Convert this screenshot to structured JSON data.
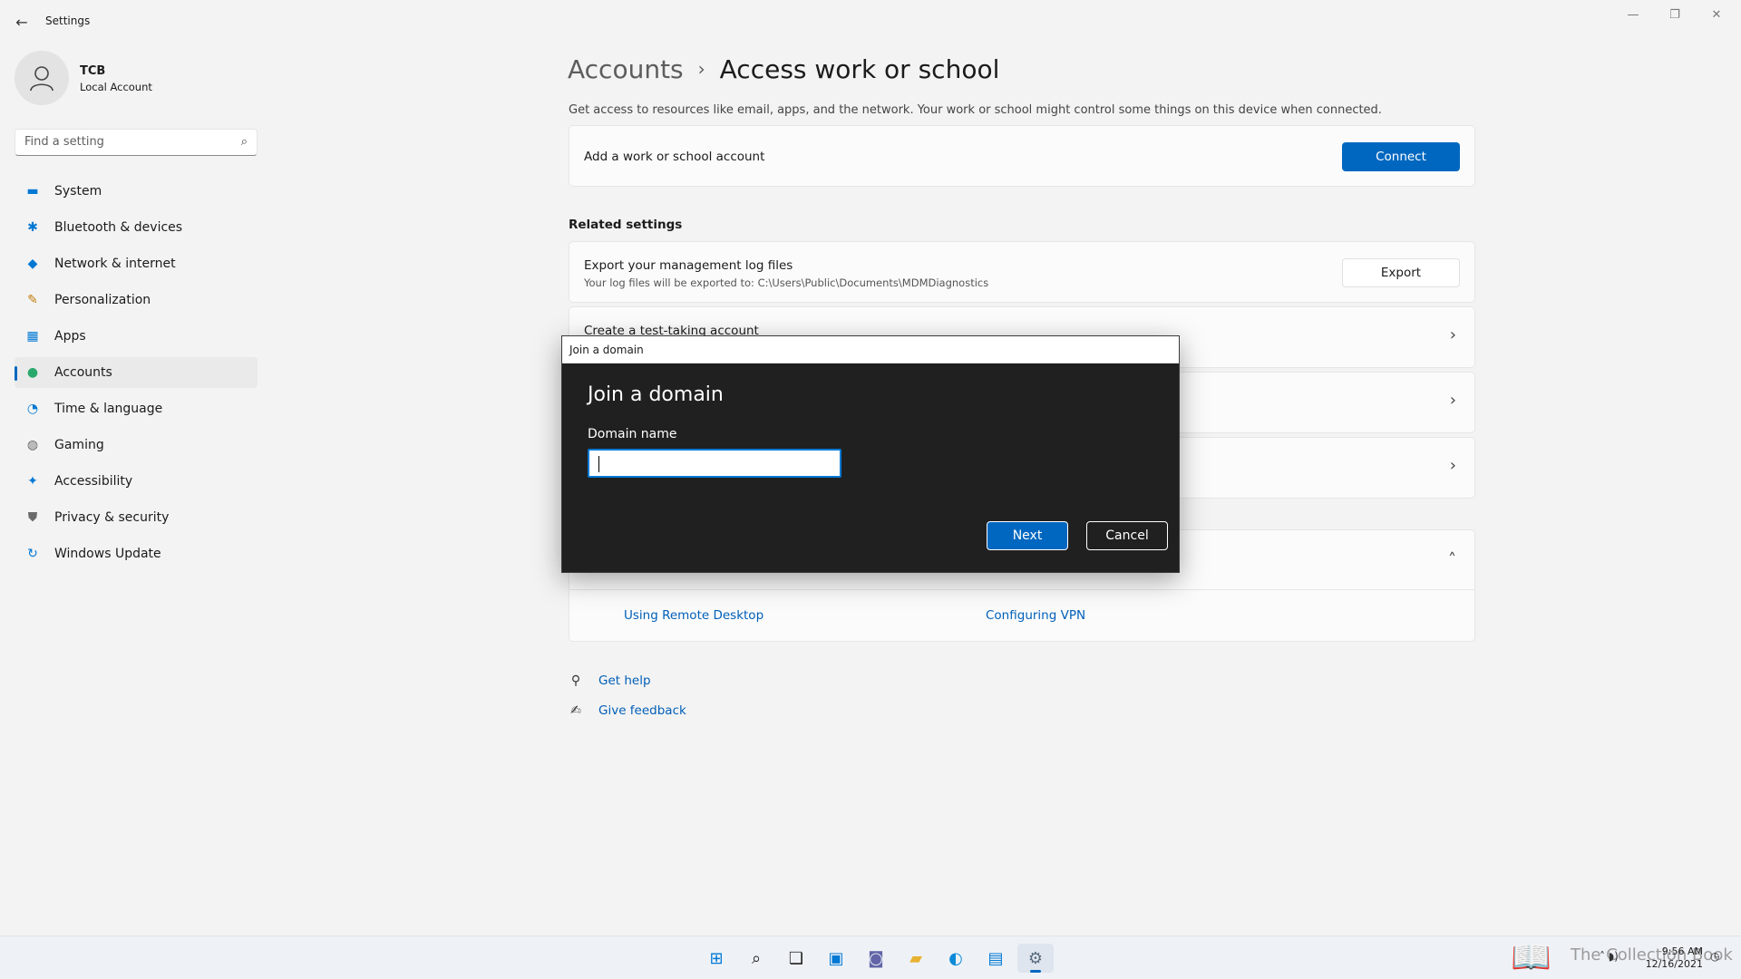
{
  "window": {
    "title": "Settings",
    "back_glyph": "←",
    "minimize_glyph": "—",
    "restore_glyph": "❐",
    "close_glyph": "✕"
  },
  "profile": {
    "name": "TCB",
    "account_type": "Local Account"
  },
  "search": {
    "placeholder": "Find a setting",
    "value": ""
  },
  "sidebar": {
    "items": [
      {
        "label": "System",
        "icon": "monitor-icon",
        "glyph": "▬",
        "color": "#0078d4"
      },
      {
        "label": "Bluetooth & devices",
        "icon": "bluetooth-icon",
        "glyph": "✱",
        "color": "#0078d4"
      },
      {
        "label": "Network & internet",
        "icon": "wifi-icon",
        "glyph": "◆",
        "color": "#0078d4"
      },
      {
        "label": "Personalization",
        "icon": "brush-icon",
        "glyph": "✎",
        "color": "#c27c0e"
      },
      {
        "label": "Apps",
        "icon": "apps-icon",
        "glyph": "▦",
        "color": "#0078d4"
      },
      {
        "label": "Accounts",
        "icon": "person-icon",
        "glyph": "●",
        "color": "#2aa86b"
      },
      {
        "label": "Time & language",
        "icon": "globe-clock-icon",
        "glyph": "◔",
        "color": "#0078d4"
      },
      {
        "label": "Gaming",
        "icon": "gamepad-icon",
        "glyph": "◍",
        "color": "#666666"
      },
      {
        "label": "Accessibility",
        "icon": "accessibility-icon",
        "glyph": "✦",
        "color": "#0078d4"
      },
      {
        "label": "Privacy & security",
        "icon": "shield-icon",
        "glyph": "⛊",
        "color": "#6b6b6b"
      },
      {
        "label": "Windows Update",
        "icon": "update-icon",
        "glyph": "↻",
        "color": "#0078d4"
      }
    ],
    "active_index": 5
  },
  "main": {
    "breadcrumb_parent": "Accounts",
    "breadcrumb_separator": "›",
    "breadcrumb_current": "Access work or school",
    "description": "Get access to resources like email, apps, and the network. Your work or school might control some things on this device when connected.",
    "add_account": {
      "label": "Add a work or school account",
      "button": "Connect"
    },
    "related_settings_title": "Related settings",
    "export": {
      "title": "Export your management log files",
      "subtitle": "Your log files will be exported to: C:\\Users\\Public\\Documents\\MDMDiagnostics",
      "button": "Export"
    },
    "test_taking": {
      "title": "Create a test-taking account"
    },
    "chevron_right": "›",
    "chevron_up": "˄",
    "help_links": {
      "remote_desktop": "Using Remote Desktop",
      "vpn": "Configuring VPN"
    },
    "get_help": "Get help",
    "give_feedback": "Give feedback"
  },
  "dialog": {
    "window_title": "Join a domain",
    "heading": "Join a domain",
    "field_label": "Domain name",
    "field_value": "",
    "next_button": "Next",
    "cancel_button": "Cancel"
  },
  "taskbar": {
    "icons": [
      {
        "name": "start-icon",
        "glyph": "⊞",
        "color": "#0078d4"
      },
      {
        "name": "search-icon",
        "glyph": "⌕",
        "color": "#1b1b1b"
      },
      {
        "name": "task-view-icon",
        "glyph": "❏",
        "color": "#1b1b1b"
      },
      {
        "name": "widgets-icon",
        "glyph": "▣",
        "color": "#0078d4"
      },
      {
        "name": "chat-icon",
        "glyph": "◙",
        "color": "#6264a7"
      },
      {
        "name": "file-explorer-icon",
        "glyph": "▰",
        "color": "#e8b130"
      },
      {
        "name": "edge-icon",
        "glyph": "◐",
        "color": "#0c8ad9"
      },
      {
        "name": "store-icon",
        "glyph": "▤",
        "color": "#0078d4"
      },
      {
        "name": "settings-icon",
        "glyph": "⚙",
        "color": "#5a6b7d"
      }
    ],
    "active_index": 8,
    "watermark": "The Collection Book",
    "time": "9:56 AM",
    "date": "12/16/2021",
    "tray_glyphs": "˄ ◗)"
  }
}
